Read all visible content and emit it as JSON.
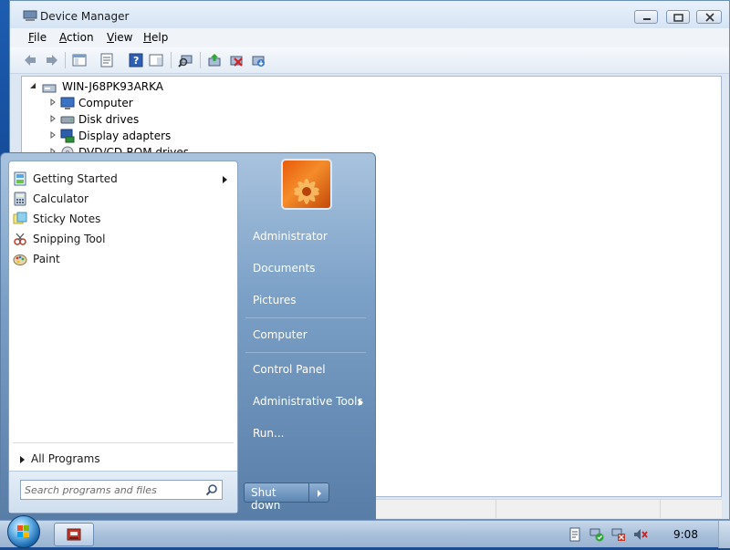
{
  "window": {
    "title": "Device Manager",
    "menu": [
      "File",
      "Action",
      "View",
      "Help"
    ],
    "menu_access_keys": [
      "F",
      "A",
      "V",
      "H"
    ]
  },
  "tree": {
    "root": "WIN-J68PK93ARKA",
    "children": [
      "Computer",
      "Disk drives",
      "Display adapters",
      "DVD/CD-ROM drives"
    ]
  },
  "start_menu": {
    "programs": [
      {
        "label": "Getting Started",
        "icon": "getting-started-icon",
        "has_submenu": true
      },
      {
        "label": "Calculator",
        "icon": "calculator-icon",
        "has_submenu": false
      },
      {
        "label": "Sticky Notes",
        "icon": "sticky-notes-icon",
        "has_submenu": false
      },
      {
        "label": "Snipping Tool",
        "icon": "snipping-tool-icon",
        "has_submenu": false
      },
      {
        "label": "Paint",
        "icon": "paint-icon",
        "has_submenu": false
      }
    ],
    "all_programs": "All Programs",
    "search_placeholder": "Search programs and files",
    "right_items": [
      {
        "label": "Administrator",
        "has_submenu": false
      },
      {
        "label": "Documents",
        "has_submenu": false
      },
      {
        "label": "Pictures",
        "has_submenu": false
      },
      {
        "label": "Computer",
        "has_submenu": false
      },
      {
        "label": "Control Panel",
        "has_submenu": false
      },
      {
        "label": "Administrative Tools",
        "has_submenu": true
      },
      {
        "label": "Run...",
        "has_submenu": false
      }
    ],
    "shutdown_label": "Shut down"
  },
  "taskbar": {
    "clock": "9:08",
    "tray_icons": [
      "action-center-icon",
      "network-icon",
      "network-disconnected-icon",
      "volume-muted-icon"
    ]
  },
  "colors": {
    "accent": "#587ea8",
    "desktop": "#1b4c92",
    "orb": "#1c6bb0"
  }
}
